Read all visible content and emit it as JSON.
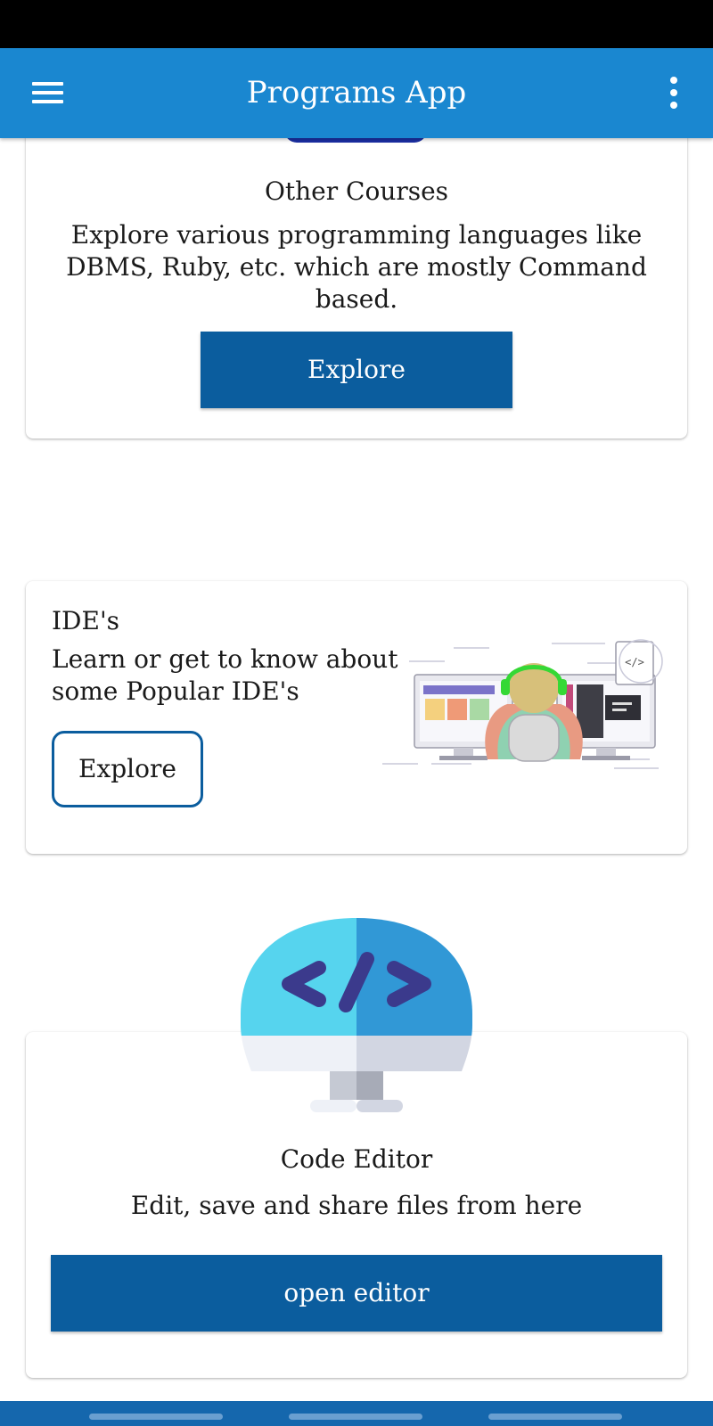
{
  "app_bar": {
    "title": "Programs App",
    "menu_icon": "hamburger-menu-icon",
    "overflow_icon": "more-vert-icon",
    "color": "#1a87d0"
  },
  "cards": {
    "other_courses": {
      "title": "Other Courses",
      "description": "Explore various programming languages like DBMS, Ruby, etc. which are mostly Command based.",
      "button_label": "Explore"
    },
    "ides": {
      "title": "IDE's",
      "description": "Learn or get to know about some Popular IDE's",
      "button_label": "Explore",
      "illustration": "developer-at-monitors-illustration"
    },
    "code_editor": {
      "icon": "code-monitor-icon",
      "icon_glyph": "</>",
      "title": "Code Editor",
      "description": "Edit, save and share files from here",
      "button_label": "open editor"
    }
  },
  "colors": {
    "primary_button": "#0b5d9e",
    "nav_bar": "#1567ad"
  }
}
